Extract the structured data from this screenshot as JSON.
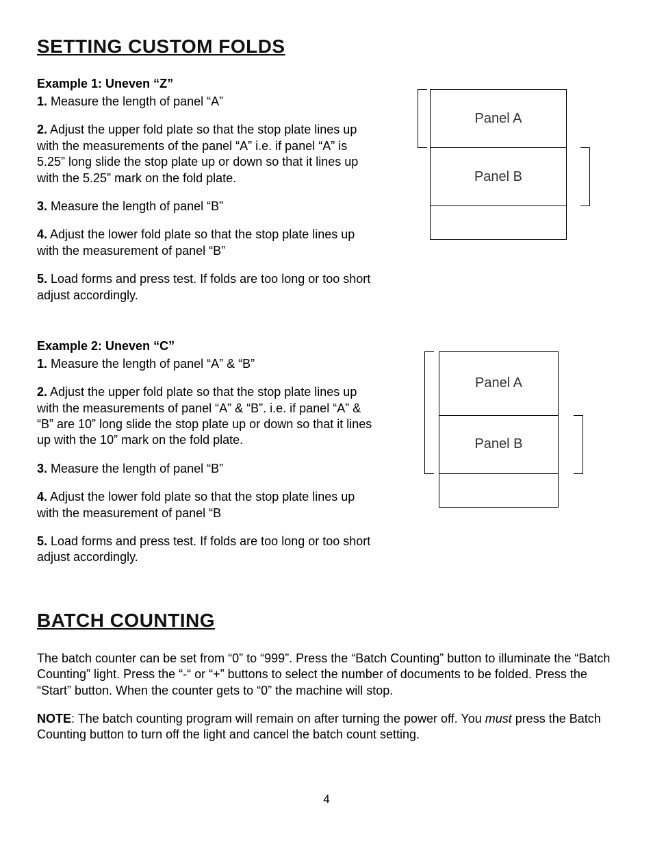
{
  "heading1": "Setting Custom Folds",
  "example1": {
    "title": "Example 1: Uneven “Z”",
    "steps": [
      {
        "num": "1.",
        "text": " Measure the length of panel “A”"
      },
      {
        "num": "2.",
        "text": " Adjust the upper fold plate so that the stop plate lines up with the measurements of the panel “A” i.e. if panel “A” is 5.25” long slide the stop plate up or down so that it lines up with the 5.25” mark on the fold plate."
      },
      {
        "num": "3.",
        "text": " Measure the length of panel “B”"
      },
      {
        "num": "4.",
        "text": " Adjust the lower fold plate so that the stop plate lines up with the measurement of panel “B”"
      },
      {
        "num": "5.",
        "text": " Load forms and press test.  If folds are too long or too short adjust accordingly."
      }
    ],
    "panel_a": "Panel A",
    "panel_b": "Panel B"
  },
  "example2": {
    "title": "Example 2: Uneven “C”",
    "steps": [
      {
        "num": "1.",
        "text": " Measure the length of panel “A” & “B”"
      },
      {
        "num": "2.",
        "text": " Adjust the upper fold plate so that the stop plate lines up with the measurements of panel “A” & “B”. i.e. if panel “A” & “B” are 10” long slide the stop plate up or down so that it lines up with the 10” mark on the fold plate."
      },
      {
        "num": "3.",
        "text": " Measure the length of panel “B”"
      },
      {
        "num": "4.",
        "text": " Adjust the lower fold plate so that the stop plate lines up with the measurement of panel “B"
      },
      {
        "num": "5.",
        "text": " Load forms and press test.  If folds are too long or too short adjust accordingly."
      }
    ],
    "panel_a": "Panel A",
    "panel_b": "Panel B"
  },
  "heading2": "Batch Counting",
  "batch": {
    "para1": "The batch counter can be set from “0” to “999”. Press the “Batch Counting” button to illuminate the “Batch Counting” light.  Press the “-“ or “+” buttons to select the number of documents to be folded.  Press the “Start” button.   When the counter gets to “0” the machine will stop.",
    "note_label": "NOTE",
    "note_before": ": The batch counting program will remain on after turning the power off.  You ",
    "note_italic": "must",
    "note_after": " press the Batch Counting button to turn off the light and cancel the batch count setting."
  },
  "page_number": "4"
}
